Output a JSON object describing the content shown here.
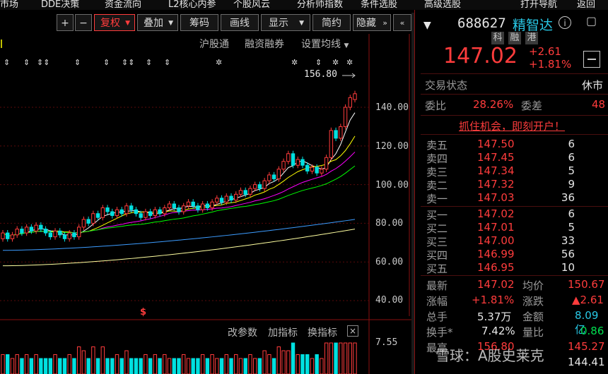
{
  "top_menu": {
    "items": [
      "市场",
      "DDE决策",
      "资金流向",
      "L2核心内参",
      "个股风云",
      "分析师指数",
      "条件选股",
      "高级选股",
      "打开导航",
      "返回"
    ]
  },
  "toolbar": {
    "plus": "+",
    "minus": "−",
    "fuquan": "复权",
    "diejia": "叠加",
    "chouma": "筹码",
    "huaxian": "画线",
    "xianshi": "显示",
    "jianyue": "简约",
    "yincang": "隐藏"
  },
  "chart_links": {
    "hugutong": "沪股通",
    "rongzi": "融资融券",
    "shezhi": "设置均线"
  },
  "chart_data": {
    "type": "candlestick",
    "y_ticks": [
      "140.00",
      "120.00",
      "100.00",
      "80.00",
      "60.00",
      "40.00"
    ],
    "ylim": [
      40,
      156.8
    ],
    "max_label": "156.80",
    "volume_tick": "7.55",
    "candles": [
      {
        "o": 72,
        "c": 75
      },
      {
        "o": 75,
        "c": 72
      },
      {
        "o": 72,
        "c": 74
      },
      {
        "o": 74,
        "c": 77
      },
      {
        "o": 77,
        "c": 75
      },
      {
        "o": 75,
        "c": 78
      },
      {
        "o": 78,
        "c": 76
      },
      {
        "o": 76,
        "c": 79
      },
      {
        "o": 79,
        "c": 77
      },
      {
        "o": 77,
        "c": 75
      },
      {
        "o": 75,
        "c": 73
      },
      {
        "o": 73,
        "c": 76
      },
      {
        "o": 76,
        "c": 74
      },
      {
        "o": 74,
        "c": 72
      },
      {
        "o": 72,
        "c": 75
      },
      {
        "o": 75,
        "c": 73
      },
      {
        "o": 73,
        "c": 78
      },
      {
        "o": 78,
        "c": 82
      },
      {
        "o": 82,
        "c": 80
      },
      {
        "o": 80,
        "c": 85
      },
      {
        "o": 85,
        "c": 83
      },
      {
        "o": 83,
        "c": 88
      },
      {
        "o": 88,
        "c": 86
      },
      {
        "o": 86,
        "c": 84
      },
      {
        "o": 84,
        "c": 87
      },
      {
        "o": 87,
        "c": 85
      },
      {
        "o": 85,
        "c": 89
      },
      {
        "o": 89,
        "c": 87
      },
      {
        "o": 87,
        "c": 85
      },
      {
        "o": 85,
        "c": 83
      },
      {
        "o": 83,
        "c": 86
      },
      {
        "o": 86,
        "c": 84
      },
      {
        "o": 84,
        "c": 87
      },
      {
        "o": 87,
        "c": 85
      },
      {
        "o": 85,
        "c": 88
      },
      {
        "o": 88,
        "c": 90
      },
      {
        "o": 90,
        "c": 88
      },
      {
        "o": 88,
        "c": 86
      },
      {
        "o": 86,
        "c": 89
      },
      {
        "o": 89,
        "c": 91
      },
      {
        "o": 91,
        "c": 89
      },
      {
        "o": 89,
        "c": 87
      },
      {
        "o": 87,
        "c": 90
      },
      {
        "o": 90,
        "c": 88
      },
      {
        "o": 88,
        "c": 91
      },
      {
        "o": 91,
        "c": 93
      },
      {
        "o": 93,
        "c": 91
      },
      {
        "o": 91,
        "c": 94
      },
      {
        "o": 94,
        "c": 92
      },
      {
        "o": 92,
        "c": 95
      },
      {
        "o": 95,
        "c": 97
      },
      {
        "o": 97,
        "c": 95
      },
      {
        "o": 95,
        "c": 98
      },
      {
        "o": 98,
        "c": 100
      },
      {
        "o": 100,
        "c": 98
      },
      {
        "o": 98,
        "c": 102
      },
      {
        "o": 102,
        "c": 105
      },
      {
        "o": 105,
        "c": 103
      },
      {
        "o": 103,
        "c": 108
      },
      {
        "o": 108,
        "c": 112
      },
      {
        "o": 112,
        "c": 116
      },
      {
        "o": 116,
        "c": 110
      },
      {
        "o": 110,
        "c": 113
      },
      {
        "o": 113,
        "c": 110
      },
      {
        "o": 110,
        "c": 107
      },
      {
        "o": 107,
        "c": 109
      },
      {
        "o": 109,
        "c": 106
      },
      {
        "o": 106,
        "c": 108
      },
      {
        "o": 108,
        "c": 114
      },
      {
        "o": 114,
        "c": 128
      },
      {
        "o": 128,
        "c": 124
      },
      {
        "o": 124,
        "c": 130
      },
      {
        "o": 130,
        "c": 140
      },
      {
        "o": 140,
        "c": 145
      },
      {
        "o": 144,
        "c": 147.02
      }
    ]
  },
  "chart_bottom": {
    "gaicanshu": "改参数",
    "jiazhibiao": "加指标",
    "huanzhibiao": "换指标",
    "close": "×"
  },
  "quote": {
    "code": "688627",
    "name": "精智达",
    "tags": [
      "科",
      "融",
      "港"
    ],
    "price": "147.02",
    "change": "+2.61",
    "change_pct": "+1.81%",
    "trade_status_label": "交易状态",
    "trade_status": "休市",
    "weibi_label": "委比",
    "weibi": "28.26%",
    "weicha_label": "委差",
    "weicha": "48",
    "promo": "抓住机会，即刻开户！"
  },
  "order_book": {
    "asks": [
      {
        "label": "卖五",
        "price": "147.50",
        "vol": "6"
      },
      {
        "label": "卖四",
        "price": "147.45",
        "vol": "6"
      },
      {
        "label": "卖三",
        "price": "147.34",
        "vol": "5"
      },
      {
        "label": "卖二",
        "price": "147.32",
        "vol": "9"
      },
      {
        "label": "卖一",
        "price": "147.03",
        "vol": "36"
      }
    ],
    "bids": [
      {
        "label": "买一",
        "price": "147.02",
        "vol": "6"
      },
      {
        "label": "买二",
        "price": "147.01",
        "vol": "5"
      },
      {
        "label": "买三",
        "price": "147.00",
        "vol": "33"
      },
      {
        "label": "买四",
        "price": "146.99",
        "vol": "56"
      },
      {
        "label": "买五",
        "price": "146.95",
        "vol": "10"
      }
    ]
  },
  "stats": {
    "zuixin_label": "最新",
    "zuixin": "147.02",
    "junjia_label": "均价",
    "junjia": "150.67",
    "zhangfu_label": "涨幅",
    "zhangfu": "+1.81%",
    "zhangdie_label": "涨跌",
    "zhangdie": "▲2.61",
    "zongshou_label": "总手",
    "zongshou": "5.37万",
    "jine_label": "金额",
    "jine": "8.09亿",
    "huanshou_label": "换手*",
    "huanshou": "7.42%",
    "liangbi_label": "量比",
    "liangbi": "0.86",
    "zuigao_label": "最高",
    "zuigao": "156.80",
    "zuigao_right": "145.27",
    "row7_right": "144.41"
  },
  "watermark": "雪球：A股史莱克",
  "colors": {
    "up": "#ff3c3c",
    "down": "#00e0e0",
    "ma5": "#ffffff",
    "ma10": "#ffff00",
    "ma20": "#ff00ff",
    "ma30": "#00ff00",
    "ma60": "#3c9cff",
    "ma120": "#ffffa0"
  }
}
